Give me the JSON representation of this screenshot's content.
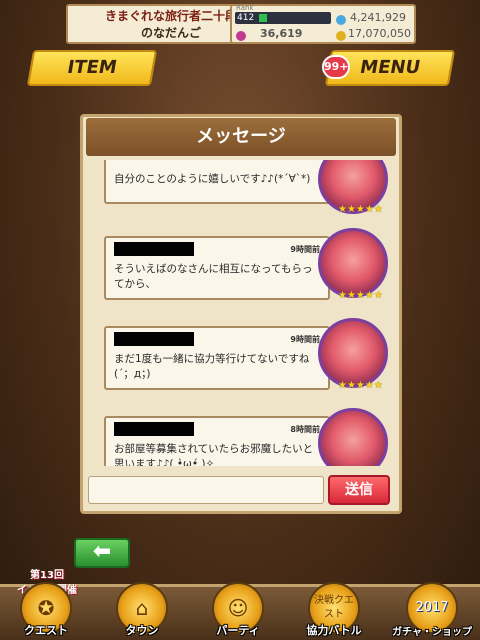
{
  "header": {
    "title": "きまぐれな旅行者二十段",
    "username": "のなだんご",
    "rank_label": "Rank",
    "rank": "412",
    "stamina": "4,241,929",
    "gems": "36,619",
    "coins": "17,070,050"
  },
  "top_buttons": {
    "item_label": "ITEM",
    "menu_label": "MENU",
    "menu_badge": "99+"
  },
  "panel": {
    "title": "メッセージ"
  },
  "messages": [
    {
      "time": "",
      "text": "自分のことのように嬉しいです♪♪(*´∀`*)"
    },
    {
      "time": "9時間前",
      "text": "そういえばのなさんに相互になってもらってから、"
    },
    {
      "time": "9時間前",
      "text": "まだ1度も一緒に協力等行けてないですね(´；д；)"
    },
    {
      "time": "8時間前",
      "text": "お部屋等募集されていたらお邪魔したいと思います♪♪( •̀ω•́ )✧"
    }
  ],
  "input": {
    "send_label": "送信"
  },
  "nav": {
    "event_line1": "第13回",
    "event_line2": "イベント開催中!",
    "items": [
      {
        "label": "クエスト",
        "icon": "quest-icon"
      },
      {
        "label": "タウン",
        "icon": "town-icon"
      },
      {
        "label": "パーティ",
        "icon": "party-icon"
      },
      {
        "label": "協力バトル",
        "icon": "coop-battle-icon"
      },
      {
        "label": "ガチャ・ショップ",
        "icon": "gacha-shop-icon"
      }
    ],
    "decisive_label": "決戦クエスト",
    "year_label": "2017"
  }
}
